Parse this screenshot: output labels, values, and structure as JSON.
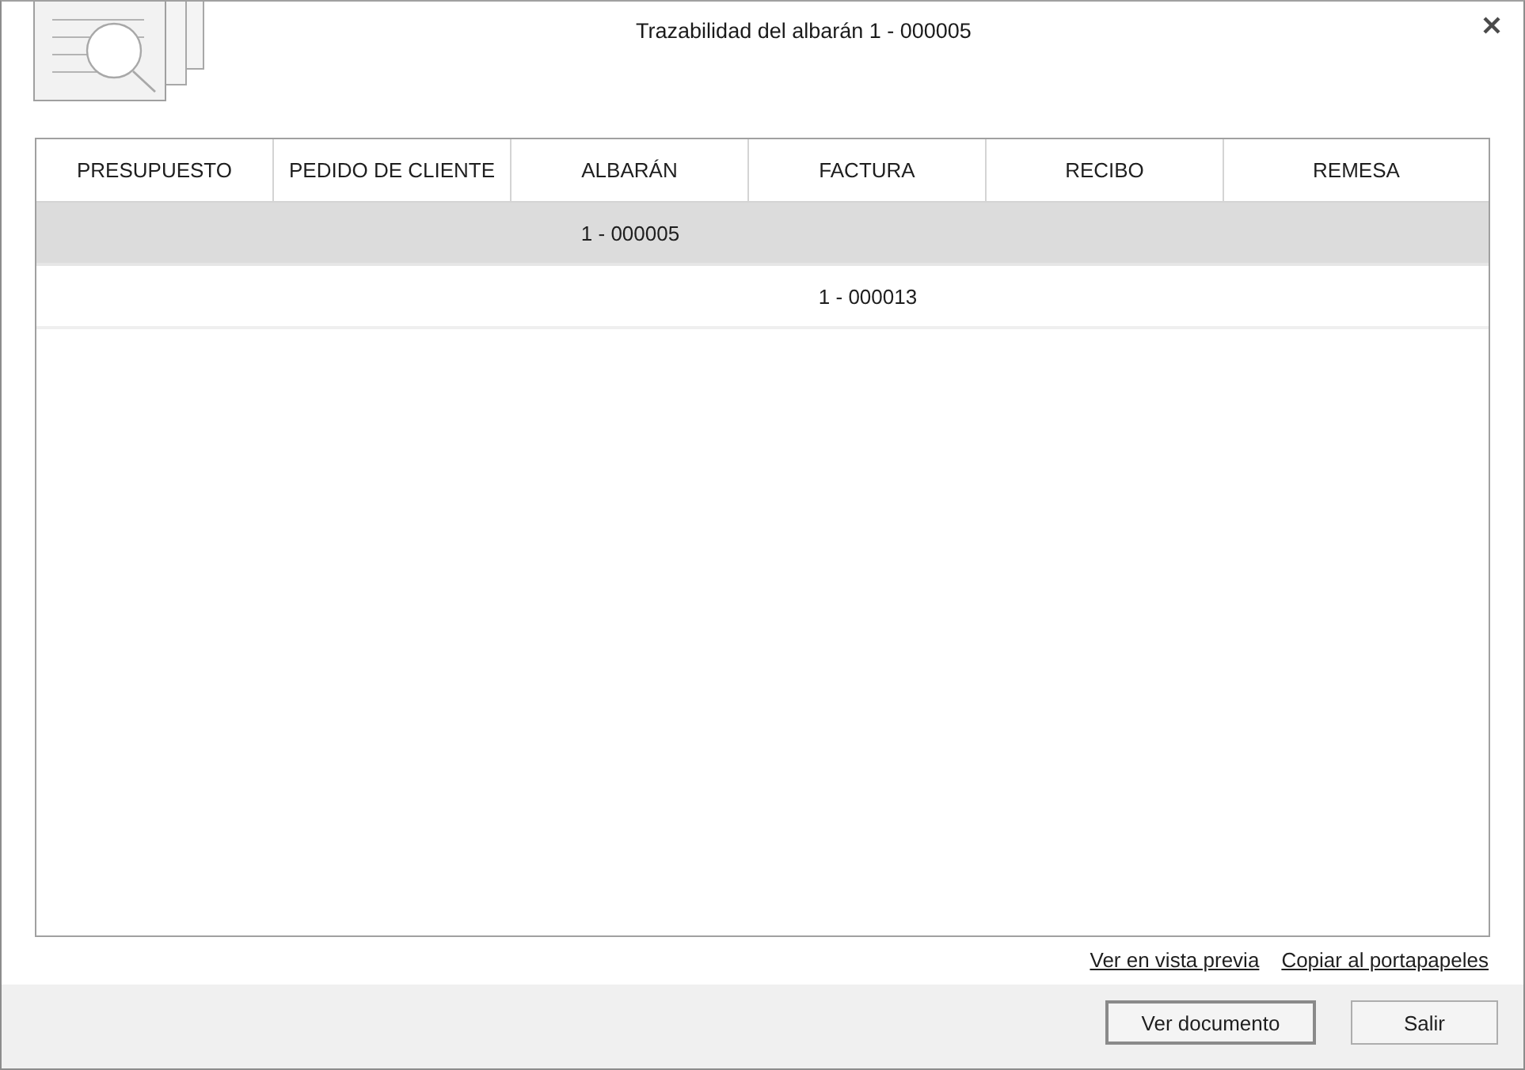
{
  "window": {
    "title": "Trazabilidad del albarán 1 - 000005"
  },
  "table": {
    "columns": [
      "PRESUPUESTO",
      "PEDIDO DE CLIENTE",
      "ALBARÁN",
      "FACTURA",
      "RECIBO",
      "REMESA"
    ],
    "rows": [
      {
        "selected": true,
        "cells": [
          null,
          null,
          "1 - 000005",
          null,
          null,
          null
        ]
      },
      {
        "selected": false,
        "cells": [
          null,
          null,
          null,
          "1 - 000013",
          null,
          null
        ]
      }
    ]
  },
  "links": [
    "Ver en vista previa",
    "Copiar al portapapeles"
  ],
  "buttons": [
    {
      "label": "Ver documento",
      "default": true
    },
    {
      "label": "Salir",
      "default": false
    }
  ]
}
